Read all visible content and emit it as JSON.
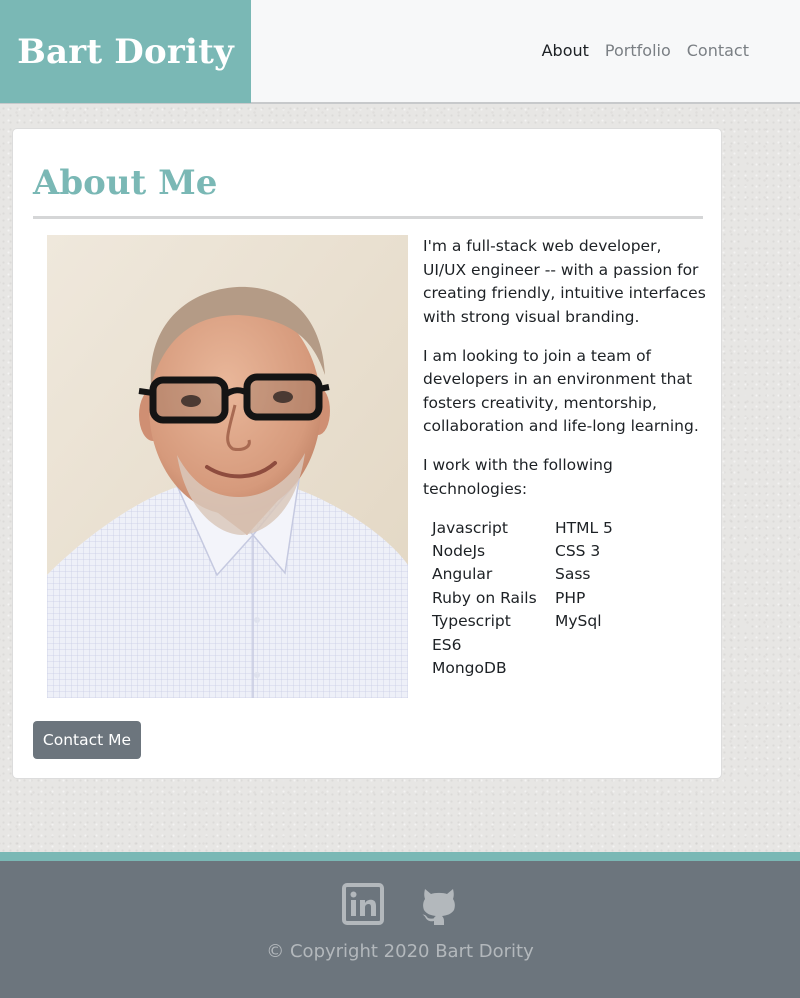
{
  "header": {
    "brand": "Bart Dority",
    "nav": [
      {
        "label": "About"
      },
      {
        "label": "Portfolio"
      },
      {
        "label": "Contact"
      }
    ]
  },
  "about": {
    "title": "About Me",
    "paragraphs": [
      "I'm a full-stack web developer, UI/UX engineer -- with a passion for creating friendly, intuitive interfaces with strong visual branding.",
      "I am looking to join a team of developers in an environment that fosters creativity, mentorship, collaboration and life-long learning.",
      "I work with the following technologies:"
    ],
    "technologies_left": [
      "Javascript",
      "NodeJs",
      "Angular",
      "Ruby on Rails",
      "Typescript",
      "ES6",
      "MongoDB"
    ],
    "technologies_right": [
      "HTML 5",
      "CSS 3",
      "Sass",
      "PHP",
      "MySql"
    ],
    "button_label": "Contact Me"
  },
  "footer": {
    "social": [
      {
        "icon": "linkedin-icon"
      },
      {
        "icon": "github-icon"
      }
    ],
    "copyright": "© Copyright 2020 Bart Dority"
  },
  "colors": {
    "accent": "#7ab8b5",
    "footer_bg": "#6c757d",
    "button_bg": "#6c757d",
    "header_bg": "#f7f8f9"
  }
}
